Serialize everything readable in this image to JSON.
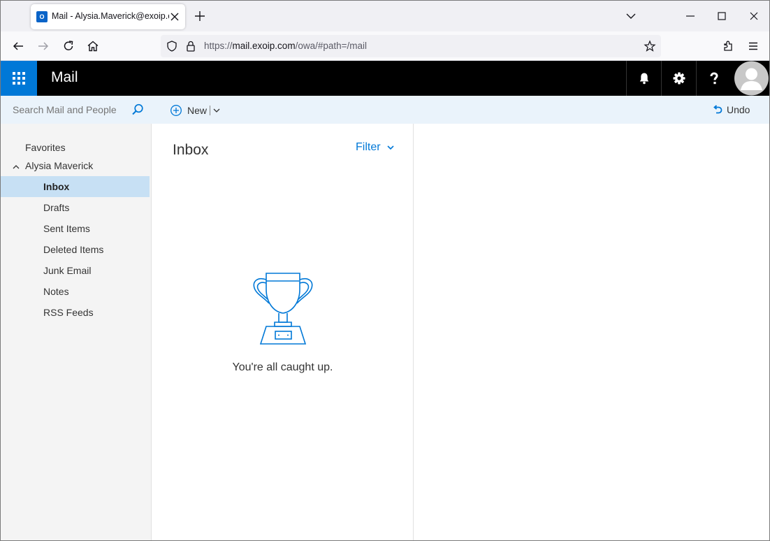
{
  "browser": {
    "tab_title": "Mail - Alysia.Maverick@exoip.com",
    "url_scheme": "https://",
    "url_host": "mail.exoip.com",
    "url_path": "/owa/#path=/mail"
  },
  "owa": {
    "app_title": "Mail",
    "search_placeholder": "Search Mail and People",
    "new_label": "New",
    "undo_label": "Undo",
    "accent_color": "#0078d7"
  },
  "folders": {
    "favorites_label": "Favorites",
    "account_label": "Alysia Maverick",
    "items": [
      {
        "label": "Inbox",
        "selected": true
      },
      {
        "label": "Drafts"
      },
      {
        "label": "Sent Items"
      },
      {
        "label": "Deleted Items"
      },
      {
        "label": "Junk Email"
      },
      {
        "label": "Notes"
      },
      {
        "label": "RSS Feeds"
      }
    ]
  },
  "message_list": {
    "title": "Inbox",
    "filter_label": "Filter",
    "empty_message": "You're all caught up."
  }
}
